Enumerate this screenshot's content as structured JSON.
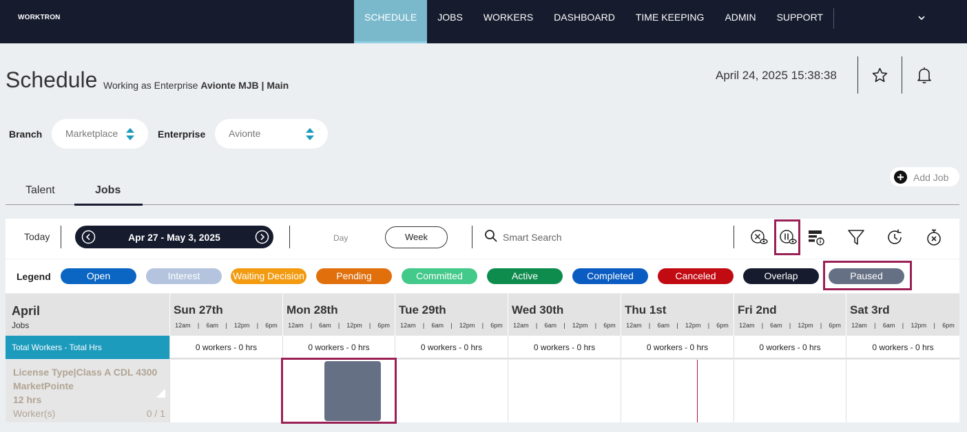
{
  "app": {
    "logo": "WORKTRON"
  },
  "nav": {
    "items": [
      "SCHEDULE",
      "JOBS",
      "WORKERS",
      "DASHBOARD",
      "TIME KEEPING",
      "ADMIN",
      "SUPPORT"
    ],
    "active": "SCHEDULE"
  },
  "header": {
    "title": "Schedule",
    "working_prefix": "Working as Enterprise",
    "working_enterprise": "Avionte MJB | Main",
    "datetime": "April 24, 2025 15:38:38"
  },
  "filters": {
    "branch_label": "Branch",
    "branch_value": "Marketplace",
    "enterprise_label": "Enterprise",
    "enterprise_value": "Avionte"
  },
  "tabs": {
    "talent": "Talent",
    "jobs": "Jobs",
    "active": "Jobs"
  },
  "add_job_label": "Add Job",
  "toolbar": {
    "today": "Today",
    "range": "Apr 27 - May 3, 2025",
    "day": "Day",
    "week": "Week",
    "search_placeholder": "Smart Search",
    "icons": [
      "hide-canceled-icon",
      "paused-visibility-icon",
      "job-info-icon",
      "filter-icon",
      "history-icon",
      "timer-icon"
    ]
  },
  "legend": {
    "label": "Legend",
    "items": [
      {
        "label": "Open",
        "color": "#0b66c3"
      },
      {
        "label": "Interest",
        "color": "#b4c4de"
      },
      {
        "label": "Waiting Decision",
        "color": "#f29b11"
      },
      {
        "label": "Pending",
        "color": "#e06f0c"
      },
      {
        "label": "Committed",
        "color": "#43c98a"
      },
      {
        "label": "Active",
        "color": "#0e8c4e"
      },
      {
        "label": "Completed",
        "color": "#0a5cc2"
      },
      {
        "label": "Canceled",
        "color": "#c10a12"
      },
      {
        "label": "Overlap",
        "color": "#161b2e"
      },
      {
        "label": "Paused",
        "color": "#667085"
      }
    ]
  },
  "grid": {
    "month": "April",
    "jobs_label": "Jobs",
    "days": [
      "Sun 27th",
      "Mon 28th",
      "Tue 29th",
      "Wed 30th",
      "Thu 1st",
      "Fri 2nd",
      "Sat 3rd"
    ],
    "ticks": [
      "12am",
      "|",
      "6am",
      "|",
      "12pm",
      "|",
      "6pm"
    ],
    "summary_label": "Total Workers - Total Hrs",
    "summary_values": [
      "0 workers - 0 hrs",
      "0 workers - 0 hrs",
      "0 workers - 0 hrs",
      "0 workers - 0 hrs",
      "0 workers - 0 hrs",
      "0 workers - 0 hrs",
      "0 workers - 0 hrs"
    ],
    "job": {
      "line1": "License Type|Class A CDL 4300",
      "line2": "MarketPointe",
      "hours": "12 hrs",
      "workers_label": "Worker(s)",
      "workers_count": "0 / 1"
    }
  }
}
